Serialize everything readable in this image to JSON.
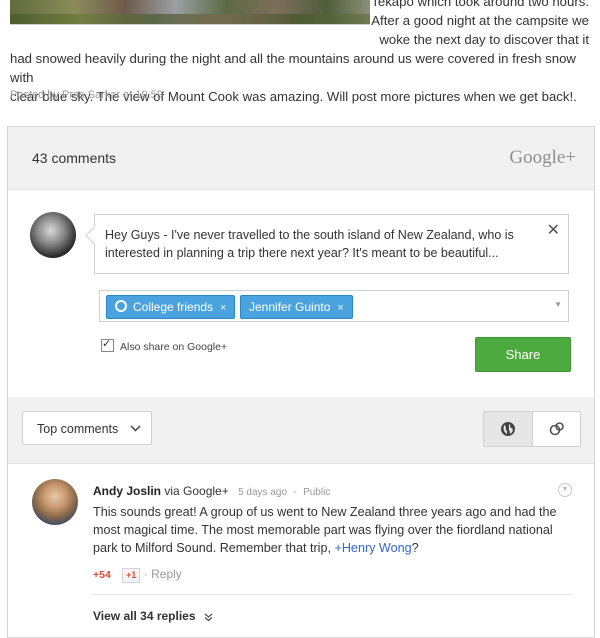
{
  "post": {
    "line1": "Tekapo which took around two hours.",
    "line2": "After a good night at the campsite we",
    "line3": "woke the next day to discover that it",
    "line4": "had snowed heavily during the night and all the mountains around us were covered in fresh snow with",
    "line5": "clear blue sky. The view of Mount Cook was amazing. Will post more pictures when we get back!.",
    "posted_by": "Posted by Pras Sarkar at 19.59"
  },
  "comments_panel": {
    "count_label": "43 comments",
    "brand": "Google+"
  },
  "compose": {
    "text": "Hey Guys - I've never travelled to the south island of New Zealand, who is interested in planning a trip there next year? It's meant to be beautiful...",
    "close_glyph": "✕",
    "chips": [
      {
        "label": "College friends",
        "remove": "×"
      },
      {
        "label": "Jennifer Guinto",
        "remove": "×"
      }
    ],
    "dropdown_glyph": "▼",
    "also_share_label": "Also share on Google+",
    "also_share_checked": true,
    "share_button": "Share"
  },
  "toolbar": {
    "sort_label": "Top comments",
    "sort_chevron": "⌵",
    "globe_icon": "globe-icon",
    "link_icon": "link-icon"
  },
  "comment": {
    "author": "Andy Joslin",
    "via": "via Google+",
    "time": "5 days ago",
    "sep": "-",
    "visibility": "Public",
    "body_prefix": "This sounds great! A group of us went to New Zealand three years ago and had the most magical time. The most memorable part was flying over the fiordland national park to Milford Sound. Remember that trip, ",
    "mention": "+Henry Wong",
    "body_suffix": "?",
    "plus_count": "+54",
    "plus_one": "+1",
    "dot": "·",
    "reply": "Reply",
    "view_replies": "View all 34 replies",
    "view_replies_chevron": "»"
  },
  "colors": {
    "share_green": "#4caa3f",
    "chip_blue": "#4aa3df",
    "mention_blue": "#3366cc",
    "plus_red": "#dd4b39"
  }
}
